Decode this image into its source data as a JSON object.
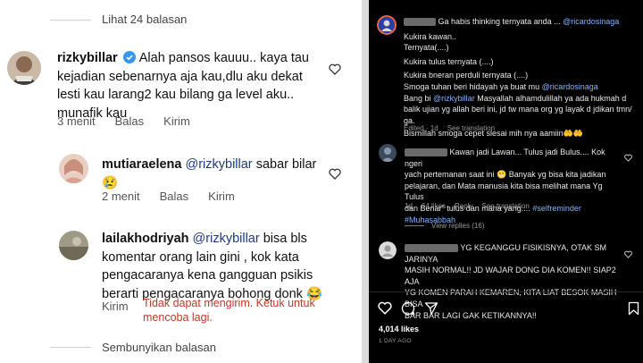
{
  "left": {
    "view_replies": "Lihat 24 balasan",
    "hide_replies": "Sembunyikan balasan",
    "comments": [
      {
        "username": "rizkybillar",
        "verified": true,
        "text_lines": [
          "Alah pansos kauuu.. kaya tau",
          "kejadian sebenarnya aja kau,dlu aku dekat",
          "lesti kau larang2 kau bilang ga level aku..",
          "munafik kau"
        ],
        "time": "3 menit",
        "reply": "Balas",
        "send": "Kirim"
      },
      {
        "username": "mutiaraelena",
        "mention": "@rizkybillar",
        "text_lines": [
          "sabar bilar",
          "😢"
        ],
        "time": "2 menit",
        "reply": "Balas",
        "send": "Kirim"
      },
      {
        "username": "lailakhodriyah",
        "mention": "@rizkybillar",
        "text_lines": [
          "bisa bls",
          "komentar orang lain gini , kok kata",
          "pengacaranya kena gangguan psikis",
          "berarti pengacaranya bohong donk 😂"
        ],
        "send": "Kirim",
        "error_lines": [
          "Tidak dapat mengirim. Ketuk untuk",
          "mencoba lagi."
        ]
      }
    ]
  },
  "right": {
    "post": {
      "caption_lines": [
        "Ga habis thinking ternyata anda ...",
        "Kukira kawan..",
        "Ternyata(....)",
        "Kukira tulus ternyata (....)",
        "Kukira bneran perduli ternyata (....)",
        "Smoga tuhan beri hidayah ya buat mu",
        "Bang bi",
        "Masyallah alhamdulillah ya ada hukmah d",
        "balik ujian yg allah beri ini, jd tw mana org yg layak d jdikan tmn/",
        "ga.",
        "Bismillah smoga cepet slesai mih nya aamiin🤲🤲"
      ],
      "mention_1": "@ricardosinaga",
      "mention_2": "@ricardosinaga",
      "mention_3": "@rizkybillar",
      "edited": "Edited · 1d",
      "see_translation": "See translation"
    },
    "comment_1": {
      "lines": [
        "Kawan jadi Lawan... Tulus jadi Bulus.... Kok ngeri",
        "yach pertemanan saat ini 😬 Banyak yg bisa kita jadikan",
        "pelajaran, dan Mata manusia kita bisa melihat mana Yg Tulus",
        "dan Benar\" tulus dan mana yang....",
        "#Muhasabbah"
      ],
      "hashtag": "#selfreminder",
      "time": "1d",
      "likes": "64 likes",
      "reply": "Reply",
      "see_translation": "See translation",
      "view_replies": "View replies (16)"
    },
    "comment_2": {
      "lines": [
        "YG KEGANGGU FISIKISNYA, OTAK SM JARINYA",
        "MASIH NORMAL!! JD WAJAR DONG DIA KOMEN!! SIAP2 AJA",
        "YG KOMEN PARAH KEMAREN, KITA LIAT BESOK MASIH BISA",
        "BAR BAR LAGI GAK KETIKANNYA!!"
      ]
    },
    "likes_count": "4,014 likes",
    "date": "1 DAY AGO"
  }
}
